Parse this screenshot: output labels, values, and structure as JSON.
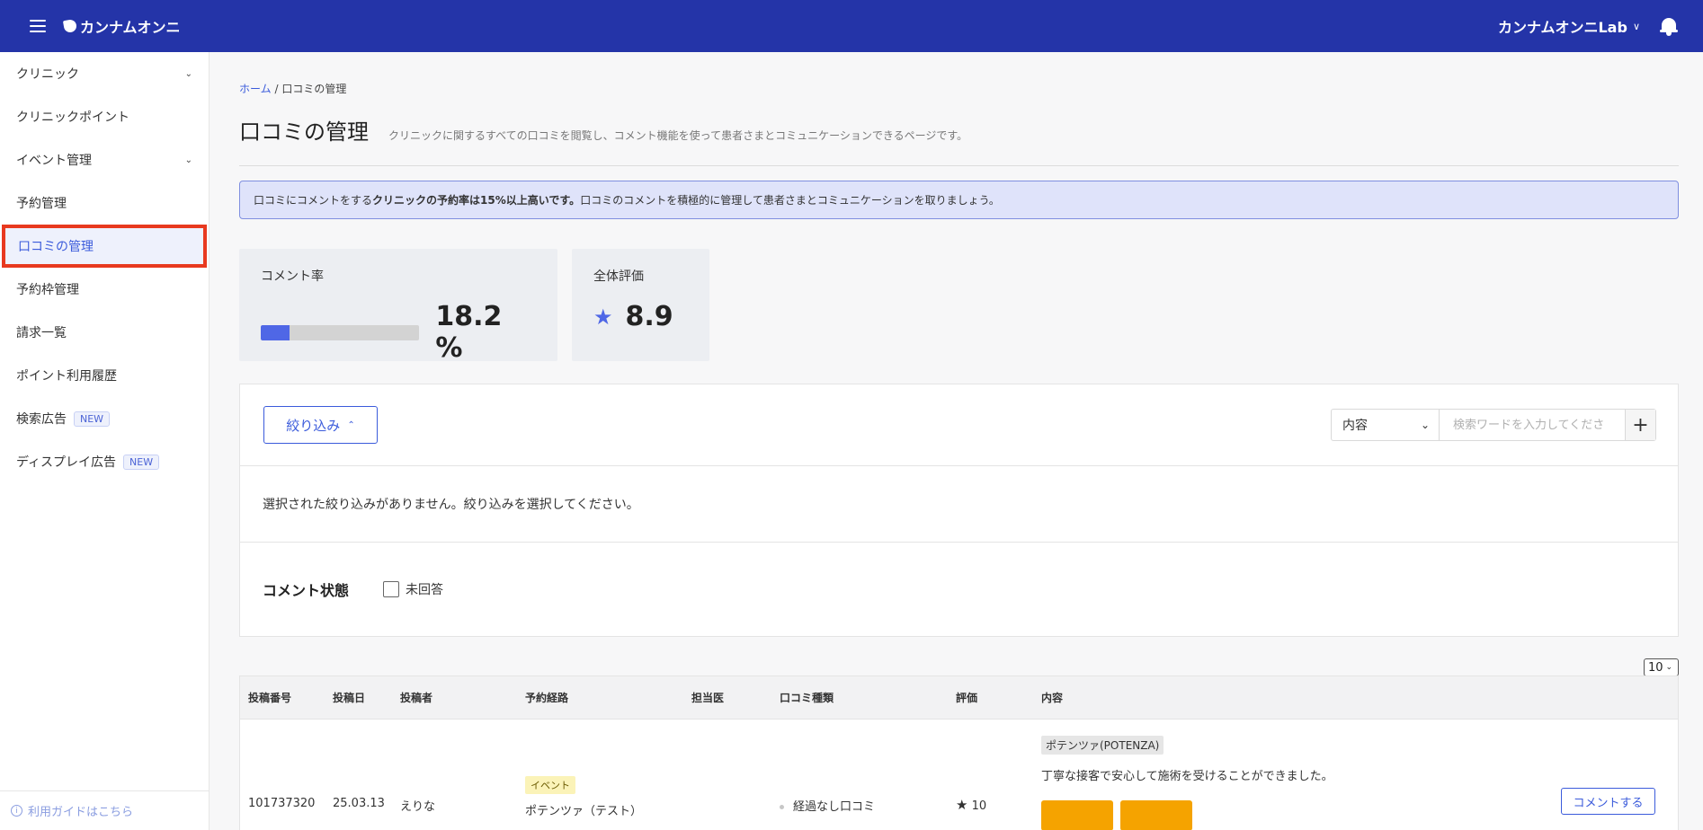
{
  "header": {
    "logo_text": "カンナムオンニ",
    "account_name": "カンナムオンニLab",
    "account_caret": "∨"
  },
  "sidebar": {
    "items": [
      {
        "label": "クリニック",
        "has_chevron": true
      },
      {
        "label": "クリニックポイント"
      },
      {
        "label": "イベント管理",
        "has_chevron": true
      },
      {
        "label": "予約管理"
      },
      {
        "label": "口コミの管理",
        "active": true
      },
      {
        "label": "予約枠管理"
      },
      {
        "label": "請求一覧"
      },
      {
        "label": "ポイント利用履歴"
      },
      {
        "label": "検索広告",
        "badge": "NEW"
      },
      {
        "label": "ディスプレイ広告",
        "badge": "NEW"
      }
    ],
    "guide_label": "利用ガイドはこちら"
  },
  "breadcrumb": {
    "home": "ホーム",
    "separator": " / ",
    "current": "口コミの管理"
  },
  "page": {
    "title": "口コミの管理",
    "description": "クリニックに関するすべての口コミを閲覧し、コメント機能を使って患者さまとコミュニケーションできるページです。"
  },
  "notice": {
    "prefix": "口コミにコメントをする",
    "bold": "クリニックの予約率は15%以上高いです。",
    "suffix": "口コミのコメントを積極的に管理して患者さまとコミュニケーションを取りましょう。"
  },
  "stats": {
    "comment_rate_label": "コメント率",
    "comment_rate_value": "18.2 %",
    "comment_rate_fraction": 0.182,
    "rating_label": "全体評価",
    "rating_value": "8.9"
  },
  "filter": {
    "button_label": "絞り込み",
    "search_select_value": "内容",
    "search_placeholder": "検索ワードを入力してくださ",
    "empty_message": "選択された絞り込みがありません。絞り込みを選択してください。",
    "comment_state_label": "コメント状態",
    "unanswered_label": "未回答"
  },
  "table": {
    "per_page": "10",
    "columns": [
      "投稿番号",
      "投稿日",
      "投稿者",
      "予約経路",
      "担当医",
      "口コミ種類",
      "評価",
      "内容"
    ],
    "rows": [
      {
        "post_id": "101737320",
        "date": "25.03.13",
        "author": "えりな",
        "route_tag": "イベント",
        "route_name": "ポテンツァ（テスト）",
        "doctor": "",
        "review_type": "経過なし口コミ",
        "rating": "10",
        "product_tag": "ポテンツァ(POTENZA)",
        "content": "丁寧な接客で安心して施術を受けることができました。",
        "comment_button": "コメントする"
      }
    ]
  },
  "colors": {
    "header_bg": "#2434a8",
    "accent": "#3b5bdb",
    "active_outline": "#e8391f",
    "image_placeholder": "#f5a300"
  }
}
